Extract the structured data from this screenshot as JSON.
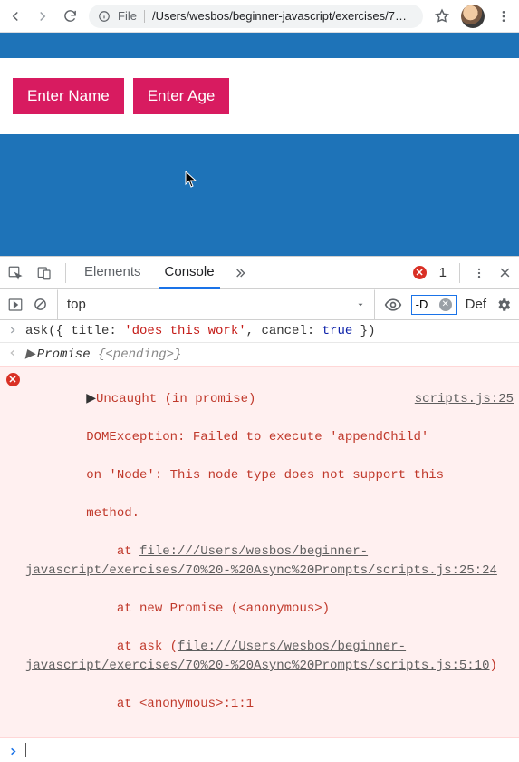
{
  "toolbar": {
    "scheme": "File",
    "path": "/Users/wesbos/beginner-javascript/exercises/7…"
  },
  "buttons": {
    "enter_name": "Enter Name",
    "enter_age": "Enter Age"
  },
  "devtools": {
    "tabs": {
      "elements": "Elements",
      "console": "Console"
    },
    "error_count": "1",
    "context": "top",
    "filter_value": "-D",
    "level_label": "Def"
  },
  "console": {
    "input_line": {
      "pre": "ask({ title: ",
      "str": "'does this work'",
      "mid": ", cancel: ",
      "bool": "true",
      "post": " })"
    },
    "result_line": {
      "label": "Promise ",
      "detail": "{<pending>}"
    },
    "error": {
      "source_link": "scripts.js:25",
      "heading": "Uncaught (in promise) ",
      "msg_l1": "DOMException: Failed to execute 'appendChild'",
      "msg_l2": "on 'Node': This node type does not support this",
      "msg_l3": "method.",
      "at1_pre": "    at ",
      "at1_link": "file:///Users/wesbos/beginner-javascript/exercises/70%20-%20Async%20Prompts/scripts.js:25:24",
      "at2": "    at new Promise (<anonymous>)",
      "at3_pre": "    at ask (",
      "at3_link": "file:///Users/wesbos/beginner-javascript/exercises/70%20-%20Async%20Prompts/scripts.js:5:10",
      "at3_post": ")",
      "at4": "    at <anonymous>:1:1"
    }
  }
}
